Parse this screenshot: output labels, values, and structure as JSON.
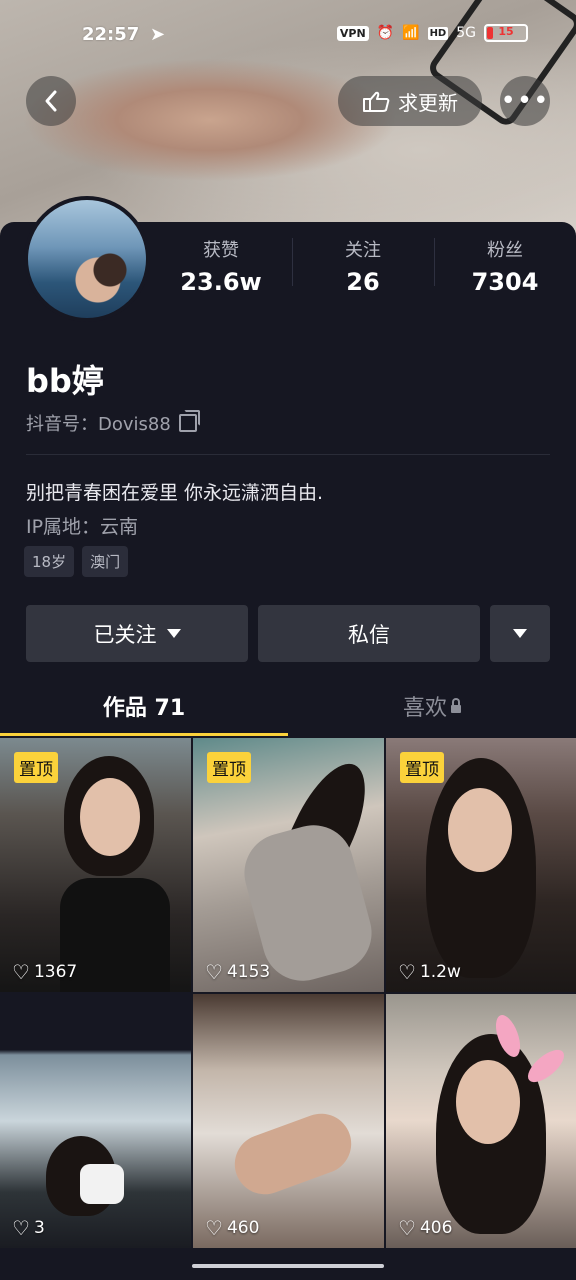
{
  "status_bar": {
    "time": "22:57",
    "vpn": "VPN",
    "hd": "HD",
    "signal": "5G",
    "battery": "15",
    "battery_fraction": 0.15
  },
  "header": {
    "back_icon": "chevron-left-icon",
    "update_label": "求更新",
    "update_icon": "hand-pointing-icon",
    "more_icon": "more-dots-icon",
    "more_label": "•••"
  },
  "profile": {
    "stats": [
      {
        "label": "获赞",
        "value": "23.6w"
      },
      {
        "label": "关注",
        "value": "26"
      },
      {
        "label": "粉丝",
        "value": "7304"
      }
    ],
    "nickname": "bb婷",
    "douyin_id": "抖音号：Dovis88",
    "bio": "别把青春困在爱里 你永远潇洒自由.",
    "ip": "IP属地：云南",
    "tags": [
      "18岁",
      "澳门"
    ]
  },
  "actions": {
    "follow": "已关注",
    "message": "私信"
  },
  "tabs": {
    "works": "作品 71",
    "likes": "喜欢"
  },
  "videos": [
    {
      "pinned": "置顶",
      "likes": "1367"
    },
    {
      "pinned": "置顶",
      "likes": "4153"
    },
    {
      "pinned": "置顶",
      "likes": "1.2w"
    },
    {
      "pinned": "",
      "likes": "3"
    },
    {
      "pinned": "",
      "likes": "460"
    },
    {
      "pinned": "",
      "likes": "406"
    }
  ],
  "colors": {
    "background": "#161722",
    "accent": "#fbd23b",
    "button": "#33353f"
  }
}
